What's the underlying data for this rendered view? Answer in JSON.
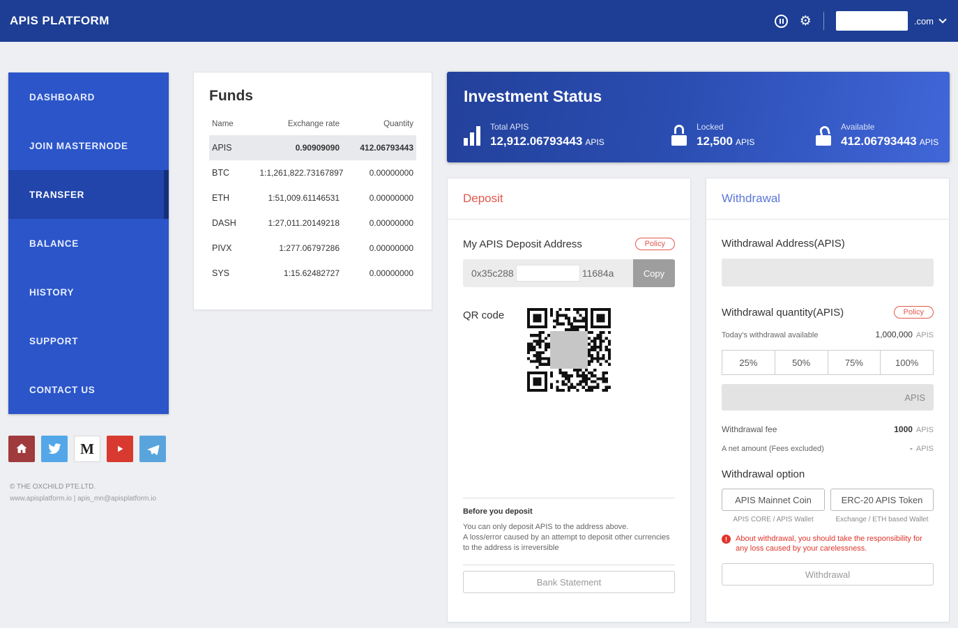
{
  "header": {
    "brand": "APIS PLATFORM",
    "account_domain": ".com"
  },
  "sidebar": {
    "items": [
      {
        "label": "DASHBOARD"
      },
      {
        "label": "JOIN MASTERNODE"
      },
      {
        "label": "TRANSFER"
      },
      {
        "label": "BALANCE"
      },
      {
        "label": "HISTORY"
      },
      {
        "label": "SUPPORT"
      },
      {
        "label": "CONTACT US"
      }
    ],
    "active_item": "TRANSFER",
    "medium_letter": "M",
    "copyright": "© THE OXCHILD PTE.LTD.",
    "contact": "www.apisplatform.io  |  apis_mn@apisplatform.io"
  },
  "funds": {
    "title": "Funds",
    "columns": {
      "name": "Name",
      "rate": "Exchange rate",
      "quantity": "Quantity"
    },
    "rows": [
      {
        "name": "APIS",
        "rate": "0.90909090",
        "quantity": "412.06793443"
      },
      {
        "name": "BTC",
        "rate": "1:1,261,822.73167897",
        "quantity": "0.00000000"
      },
      {
        "name": "ETH",
        "rate": "1:51,009.61146531",
        "quantity": "0.00000000"
      },
      {
        "name": "DASH",
        "rate": "1:27,011.20149218",
        "quantity": "0.00000000"
      },
      {
        "name": "PIVX",
        "rate": "1:277.06797286",
        "quantity": "0.00000000"
      },
      {
        "name": "SYS",
        "rate": "1:15.62482727",
        "quantity": "0.00000000"
      }
    ]
  },
  "investment": {
    "title": "Investment Status",
    "stats": [
      {
        "label": "Total APIS",
        "value": "12,912.06793443",
        "unit": "APIS"
      },
      {
        "label": "Locked",
        "value": "12,500",
        "unit": "APIS"
      },
      {
        "label": "Available",
        "value": "412.06793443",
        "unit": "APIS"
      }
    ]
  },
  "deposit": {
    "title": "Deposit",
    "address_label": "My APIS Deposit Address",
    "policy_label": "Policy",
    "address_prefix": "0x35c288",
    "address_suffix": "11684a",
    "copy_label": "Copy",
    "qr_label": "QR code",
    "notice_title": "Before you deposit",
    "notice_line1": "You can only deposit APIS to the address above.",
    "notice_line2": "A loss/error caused by an attempt to deposit other currencies to the address is irreversible",
    "bank_statement_label": "Bank Statement"
  },
  "withdrawal": {
    "title": "Withdrawal",
    "address_label": "Withdrawal Address(APIS)",
    "quantity_label": "Withdrawal quantity(APIS)",
    "policy_label": "Policy",
    "available_label": "Today's withdrawal available",
    "available_value": "1,000,000",
    "available_unit": "APIS",
    "percent_buttons": [
      "25%",
      "50%",
      "75%",
      "100%"
    ],
    "amount_suffix": "APIS",
    "fee_label": "Withdrawal fee",
    "fee_value": "1000",
    "fee_unit": "APIS",
    "net_label": "A net amount (Fees excluded)",
    "net_value": "-",
    "net_unit": "APIS",
    "option_label": "Withdrawal option",
    "options": [
      {
        "label": "APIS Mainnet Coin",
        "caption": "APIS CORE / APIS Wallet"
      },
      {
        "label": "ERC-20 APIS Token",
        "caption": "Exchange / ETH based Wallet"
      }
    ],
    "warning": "About withdrawal, you should take the responsibility for any loss caused by your carelessness.",
    "submit_label": "Withdrawal"
  },
  "colors": {
    "header_bg": "#1d3e94",
    "sidebar_bg": "#2b55c8",
    "accent_red": "#e2574c",
    "accent_blue": "#5b76d7"
  }
}
